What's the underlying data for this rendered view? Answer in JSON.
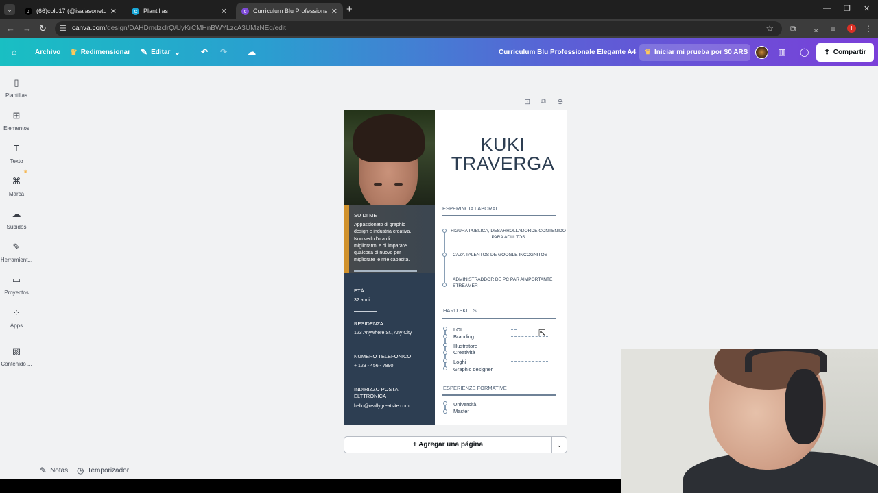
{
  "browser": {
    "tabs": [
      {
        "title": "(66)colo17 (@isaiasoneto) | TikTok",
        "icon": "tiktok-icon",
        "active": false
      },
      {
        "title": "Plantillas",
        "icon": "canva-icon",
        "active": false
      },
      {
        "title": "Curriculum Blu Professionale Elegante A4",
        "icon": "canva-icon",
        "active": true
      }
    ],
    "url_host": "canva.com",
    "url_path": "/design/DAHDmdzclrQ/UyKrCMHnBWYLzcA3UMzNEg/edit",
    "profile_initial": "I"
  },
  "header": {
    "home_icon": "home-icon",
    "archivo": "Archivo",
    "redimensionar": "Redimensionar",
    "editar": "Editar",
    "doc_title": "Curriculum Blu Professionale Elegante A4",
    "trial": "Iniciar mi prueba por $0 ARS",
    "share": "Compartir",
    "brand_gradient": [
      "#19bfc3",
      "#7a3fd8"
    ]
  },
  "sidebar": [
    {
      "label": "Plantillas",
      "icon": "templates-icon"
    },
    {
      "label": "Elementos",
      "icon": "elements-icon"
    },
    {
      "label": "Texto",
      "icon": "text-icon"
    },
    {
      "label": "Marca",
      "icon": "brand-icon"
    },
    {
      "label": "Subidos",
      "icon": "upload-icon"
    },
    {
      "label": "Herramient...",
      "icon": "draw-icon"
    },
    {
      "label": "Proyectos",
      "icon": "folder-icon"
    },
    {
      "label": "Apps",
      "icon": "apps-icon"
    },
    {
      "label": "Contenido ...",
      "icon": "magic-media-icon"
    }
  ],
  "resume": {
    "name_line1": "KUKI",
    "name_line2": "TRAVERGA",
    "about_title": "SU DI ME",
    "about_lines": [
      "Appassionato di graphic",
      "design e industria creativa.",
      "Non vedo l'ora di",
      "migliorarmi e di imparare",
      "qualcosa di nuovo per",
      "migliorare le mie capacità."
    ],
    "eta_title": "ETÀ",
    "eta_value": "32 anni",
    "residenza_title": "RESIDENZA",
    "residenza_value": "123 Anywhere St., Any City",
    "telefono_title": "NUMERO TELEFONICO",
    "telefono_value": "+ 123 - 456 - 7890",
    "email_title_line1": "INDIRIZZO POSTA",
    "email_title_line2": "ELTTRONICA",
    "email_value": "hello@reallygreatsite.com",
    "exp_title": "ESPERINCIA LABORAL",
    "jobs": [
      {
        "line1": "FIGURA PUBLICA, DESARROLLADORDE CONTENIDO",
        "line2": "PARA ADULTOS"
      },
      {
        "line1": "CAZA TALENTOS DE GOOGLE INCOGNITOS",
        "line2": ""
      },
      {
        "line1": "ADMINISTRADDOR  DE PC PAR AIMPORTANTE",
        "line2": "STREAMER"
      }
    ],
    "skills_title": "HARD SKILLS",
    "skills": [
      "LOL",
      "Branding",
      "Illustratore",
      "Creatività",
      "Loghi",
      "Graphic designer"
    ],
    "skill_levels": [
      0.15,
      1.0,
      1.0,
      1.0,
      1.0,
      1.0
    ],
    "edu_title": "ESPERIENZE FORMATIVE",
    "edu": [
      "Università",
      "Master"
    ]
  },
  "canvas": {
    "add_page": "+ Agregar una página"
  },
  "footer": {
    "notes": "Notas",
    "timer": "Temporizador"
  }
}
